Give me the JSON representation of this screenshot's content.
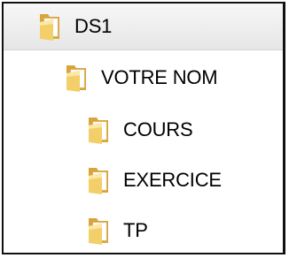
{
  "tree": {
    "root": {
      "label": "DS1",
      "icon": "folder-icon"
    },
    "child": {
      "label": "VOTRE NOM",
      "icon": "folder-icon"
    },
    "grandchildren": [
      {
        "label": "COURS",
        "icon": "folder-icon"
      },
      {
        "label": "EXERCICE",
        "icon": "folder-icon"
      },
      {
        "label": "TP",
        "icon": "folder-icon"
      }
    ]
  },
  "colors": {
    "folder_back": "#d9a53a",
    "folder_front": "#f3cf6a",
    "folder_highlight": "#fbe7a6",
    "paper": "#ffffff",
    "selection_bg": "#ececec"
  }
}
